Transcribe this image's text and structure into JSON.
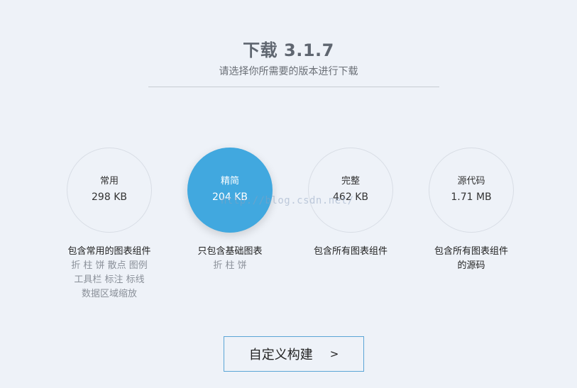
{
  "header": {
    "title": "下载 3.1.7",
    "subtitle": "请选择你所需要的版本进行下载"
  },
  "packages": [
    {
      "name": "常用",
      "size": "298 KB",
      "desc_main": "包含常用的图表组件",
      "desc_lines": [
        "折 柱 饼 散点 图例",
        "工具栏 标注 标线",
        "数据区域缩放"
      ],
      "selected": false
    },
    {
      "name": "精简",
      "size": "204 KB",
      "desc_main": "只包含基础图表",
      "desc_lines": [
        "折 柱 饼"
      ],
      "selected": true
    },
    {
      "name": "完整",
      "size": "462 KB",
      "desc_main": "包含所有图表组件",
      "desc_lines": [],
      "selected": false
    },
    {
      "name": "源代码",
      "size": "1.71 MB",
      "desc_main": "包含所有图表组件",
      "desc_lines": [
        "的源码"
      ],
      "selected": false
    }
  ],
  "watermark": "http://blog.csdn.net/",
  "custom_build": {
    "label": "自定义构建",
    "arrow": ">"
  },
  "colors": {
    "background": "#eef2f8",
    "accent": "#41a8df",
    "button_border": "#5aa5d6",
    "subtext": "#8a9099"
  }
}
